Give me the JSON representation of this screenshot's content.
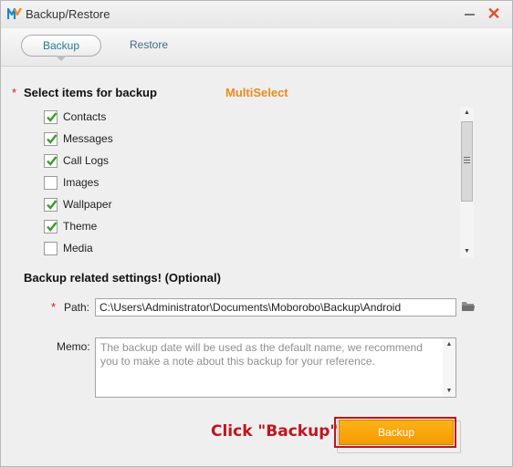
{
  "window": {
    "title": "Backup/Restore",
    "minimize_symbol": "—",
    "close_symbol": "✕",
    "accent_close": "#d9552b"
  },
  "tabs": [
    {
      "label": "Backup",
      "active": true
    },
    {
      "label": "Restore",
      "active": false
    }
  ],
  "select_section": {
    "required_mark": "*",
    "title": "Select items for backup",
    "multiselect_label": "MultiSelect",
    "items": [
      {
        "label": "Contacts",
        "checked": true
      },
      {
        "label": "Messages",
        "checked": true
      },
      {
        "label": "Call Logs",
        "checked": true
      },
      {
        "label": "Images",
        "checked": false
      },
      {
        "label": "Wallpaper",
        "checked": true
      },
      {
        "label": "Theme",
        "checked": true
      },
      {
        "label": "Media",
        "checked": false
      }
    ]
  },
  "settings": {
    "title": "Backup related settings! (Optional)",
    "path_required_mark": "*",
    "path_label": "Path:",
    "path_value": "C:\\Users\\Administrator\\Documents\\Moborobo\\Backup\\Android",
    "memo_label": "Memo:",
    "memo_placeholder": "The backup date will be used as the default name, we recommend you to make a note about this backup for your reference."
  },
  "action": {
    "hint": "Click \"Backup\"",
    "backup_button_label": "Backup",
    "button_color": "#f7a20a",
    "highlight_color": "#c0141d"
  },
  "icons": {
    "app_logo": "moborobo-logo-icon",
    "folder": "folder-icon",
    "checkmark": "check-icon"
  }
}
